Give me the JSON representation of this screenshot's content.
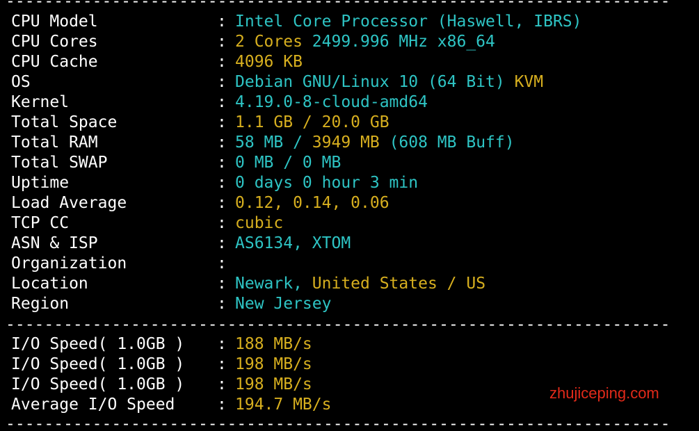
{
  "rows": [
    {
      "label": "CPU Model",
      "colon": ":",
      "parts": [
        {
          "text": "Intel Core Processor (Haswell, IBRS)",
          "color": "cyan"
        }
      ]
    },
    {
      "label": "CPU Cores",
      "colon": ":",
      "parts": [
        {
          "text": "2 Cores ",
          "color": "yellow"
        },
        {
          "text": "2499.996 MHz x86_64",
          "color": "cyan"
        }
      ]
    },
    {
      "label": "CPU Cache",
      "colon": ":",
      "parts": [
        {
          "text": "4096 KB",
          "color": "yellow"
        }
      ]
    },
    {
      "label": "OS",
      "colon": ":",
      "parts": [
        {
          "text": "Debian GNU/Linux 10 (64 Bit) ",
          "color": "cyan"
        },
        {
          "text": "KVM",
          "color": "yellow"
        }
      ]
    },
    {
      "label": "Kernel",
      "colon": ":",
      "parts": [
        {
          "text": "4.19.0-8-cloud-amd64",
          "color": "cyan"
        }
      ]
    },
    {
      "label": "Total Space",
      "colon": ":",
      "parts": [
        {
          "text": "1.1 GB / ",
          "color": "yellow"
        },
        {
          "text": "20.0 GB",
          "color": "yellow"
        }
      ]
    },
    {
      "label": "Total RAM",
      "colon": ":",
      "parts": [
        {
          "text": "58 MB / ",
          "color": "cyan"
        },
        {
          "text": "3949 MB",
          "color": "yellow"
        },
        {
          "text": " (608 MB Buff)",
          "color": "cyan"
        }
      ]
    },
    {
      "label": "Total SWAP",
      "colon": ":",
      "parts": [
        {
          "text": "0 MB / 0 MB",
          "color": "cyan"
        }
      ]
    },
    {
      "label": "Uptime",
      "colon": ":",
      "parts": [
        {
          "text": "0 days 0 hour 3 min",
          "color": "cyan"
        }
      ]
    },
    {
      "label": "Load Average",
      "colon": ":",
      "parts": [
        {
          "text": "0.12, 0.14, 0.06",
          "color": "yellow"
        }
      ]
    },
    {
      "label": "TCP CC",
      "colon": ":",
      "parts": [
        {
          "text": "cubic",
          "color": "yellow"
        }
      ]
    },
    {
      "label": "ASN & ISP",
      "colon": ":",
      "parts": [
        {
          "text": "AS6134, XTOM",
          "color": "cyan"
        }
      ]
    },
    {
      "label": "Organization",
      "colon": ":",
      "parts": []
    },
    {
      "label": "Location",
      "colon": ":",
      "parts": [
        {
          "text": "Newark, ",
          "color": "cyan"
        },
        {
          "text": "United States / ",
          "color": "yellow"
        },
        {
          "text": "US",
          "color": "yellow"
        }
      ]
    },
    {
      "label": "Region",
      "colon": ":",
      "parts": [
        {
          "text": "New Jersey",
          "color": "cyan"
        }
      ]
    }
  ],
  "io_rows": [
    {
      "label": "I/O Speed( 1.0GB )",
      "colon": ":",
      "parts": [
        {
          "text": "188 MB/s",
          "color": "yellow"
        }
      ]
    },
    {
      "label": "I/O Speed( 1.0GB )",
      "colon": ":",
      "parts": [
        {
          "text": "198 MB/s",
          "color": "yellow"
        }
      ]
    },
    {
      "label": "I/O Speed( 1.0GB )",
      "colon": ":",
      "parts": [
        {
          "text": "198 MB/s",
          "color": "yellow"
        }
      ]
    },
    {
      "label": "Average I/O Speed",
      "colon": ":",
      "parts": [
        {
          "text": "194.7 MB/s",
          "color": "yellow"
        }
      ]
    }
  ],
  "separator": "---------------------------------------------------------------------",
  "watermark": "zhujiceping.com",
  "colors": {
    "background": "#000000",
    "label": "#ffffff",
    "cyan": "#2ec4c4",
    "yellow": "#d7af1f",
    "watermark": "#e22a1a"
  }
}
